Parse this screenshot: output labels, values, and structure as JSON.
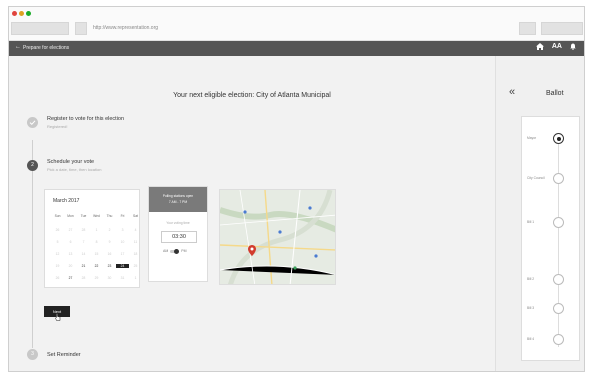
{
  "browser": {
    "url": "http://www.representation.org"
  },
  "appbar": {
    "back_icon": "arrow-left-icon",
    "title": "Prepare for elections",
    "text_size_label": "AA"
  },
  "main": {
    "headline": "Your next eligible election: City of Atlanta Municipal",
    "steps": [
      {
        "number": "",
        "title": "Register to vote for this election",
        "subtitle": "Registered!"
      },
      {
        "number": "2",
        "title": "Schedule your vote",
        "subtitle": "Pick a date, time, then location"
      },
      {
        "number": "3",
        "title": "Set Reminder",
        "subtitle": ""
      }
    ],
    "calendar": {
      "month_label": "March 2017",
      "weekdays": [
        "Sun",
        "Mon",
        "Tue",
        "Wed",
        "Thu",
        "Fri",
        "Sat"
      ],
      "weeks": [
        [
          "26",
          "27",
          "28",
          "1",
          "2",
          "3",
          "4"
        ],
        [
          "5",
          "6",
          "7",
          "8",
          "9",
          "10",
          "11"
        ],
        [
          "12",
          "13",
          "14",
          "15",
          "16",
          "17",
          "18"
        ],
        [
          "19",
          "20",
          "21",
          "22",
          "23",
          "24",
          "25"
        ],
        [
          "26",
          "27",
          "28",
          "29",
          "30",
          "31",
          "1"
        ]
      ],
      "selected": "24"
    },
    "time_card": {
      "header_line1": "Polling stations open",
      "header_line2": "7 AM - 7 PM",
      "label": "Your voting time",
      "time": "03:30",
      "am": "AM",
      "pm": "PM"
    },
    "next_button": "Next"
  },
  "panel": {
    "collapse_icon": "double-chevron-left-icon",
    "title": "Ballot",
    "items": [
      {
        "label": "Mayor",
        "active": true
      },
      {
        "label": "City Council",
        "active": false
      },
      {
        "label": "Bill 1",
        "active": false
      },
      {
        "label": "Bill 2",
        "active": false
      },
      {
        "label": "Bill 3",
        "active": false
      },
      {
        "label": "Bill 4",
        "active": false
      }
    ]
  },
  "colors": {
    "appbar": "#555555",
    "step_done": "#c8c8c8",
    "step_current": "#555555",
    "accent_dark": "#222222",
    "map_pin": "#d23b2e"
  }
}
